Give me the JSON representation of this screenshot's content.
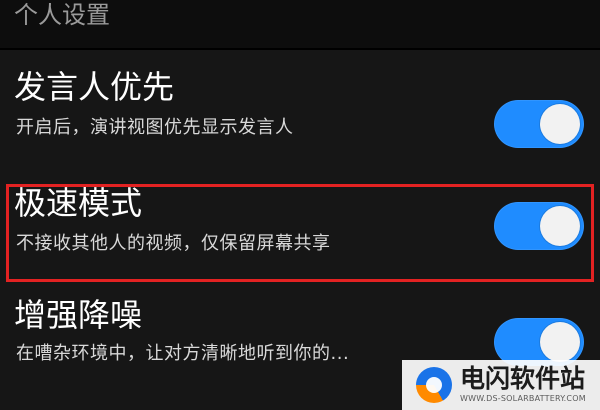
{
  "header": {
    "title": "个人设置"
  },
  "settings": [
    {
      "title": "发言人优先",
      "subtitle": "开启后，演讲视图优先显示发言人",
      "enabled": true
    },
    {
      "title": "极速模式",
      "subtitle": "不接收其他人的视频，仅保留屏幕共享",
      "enabled": true,
      "highlighted": true
    },
    {
      "title": "增强降噪",
      "subtitle": "在嘈杂环境中，让对方清晰地听到你的...",
      "enabled": true
    }
  ],
  "watermark": {
    "title": "电闪软件站",
    "url": "WWW.DS-SOLARBATTERY.COM"
  },
  "colors": {
    "background": "#161616",
    "header": "#0d0d0d",
    "toggle_on": "#1f8cff",
    "highlight": "#e32222"
  }
}
